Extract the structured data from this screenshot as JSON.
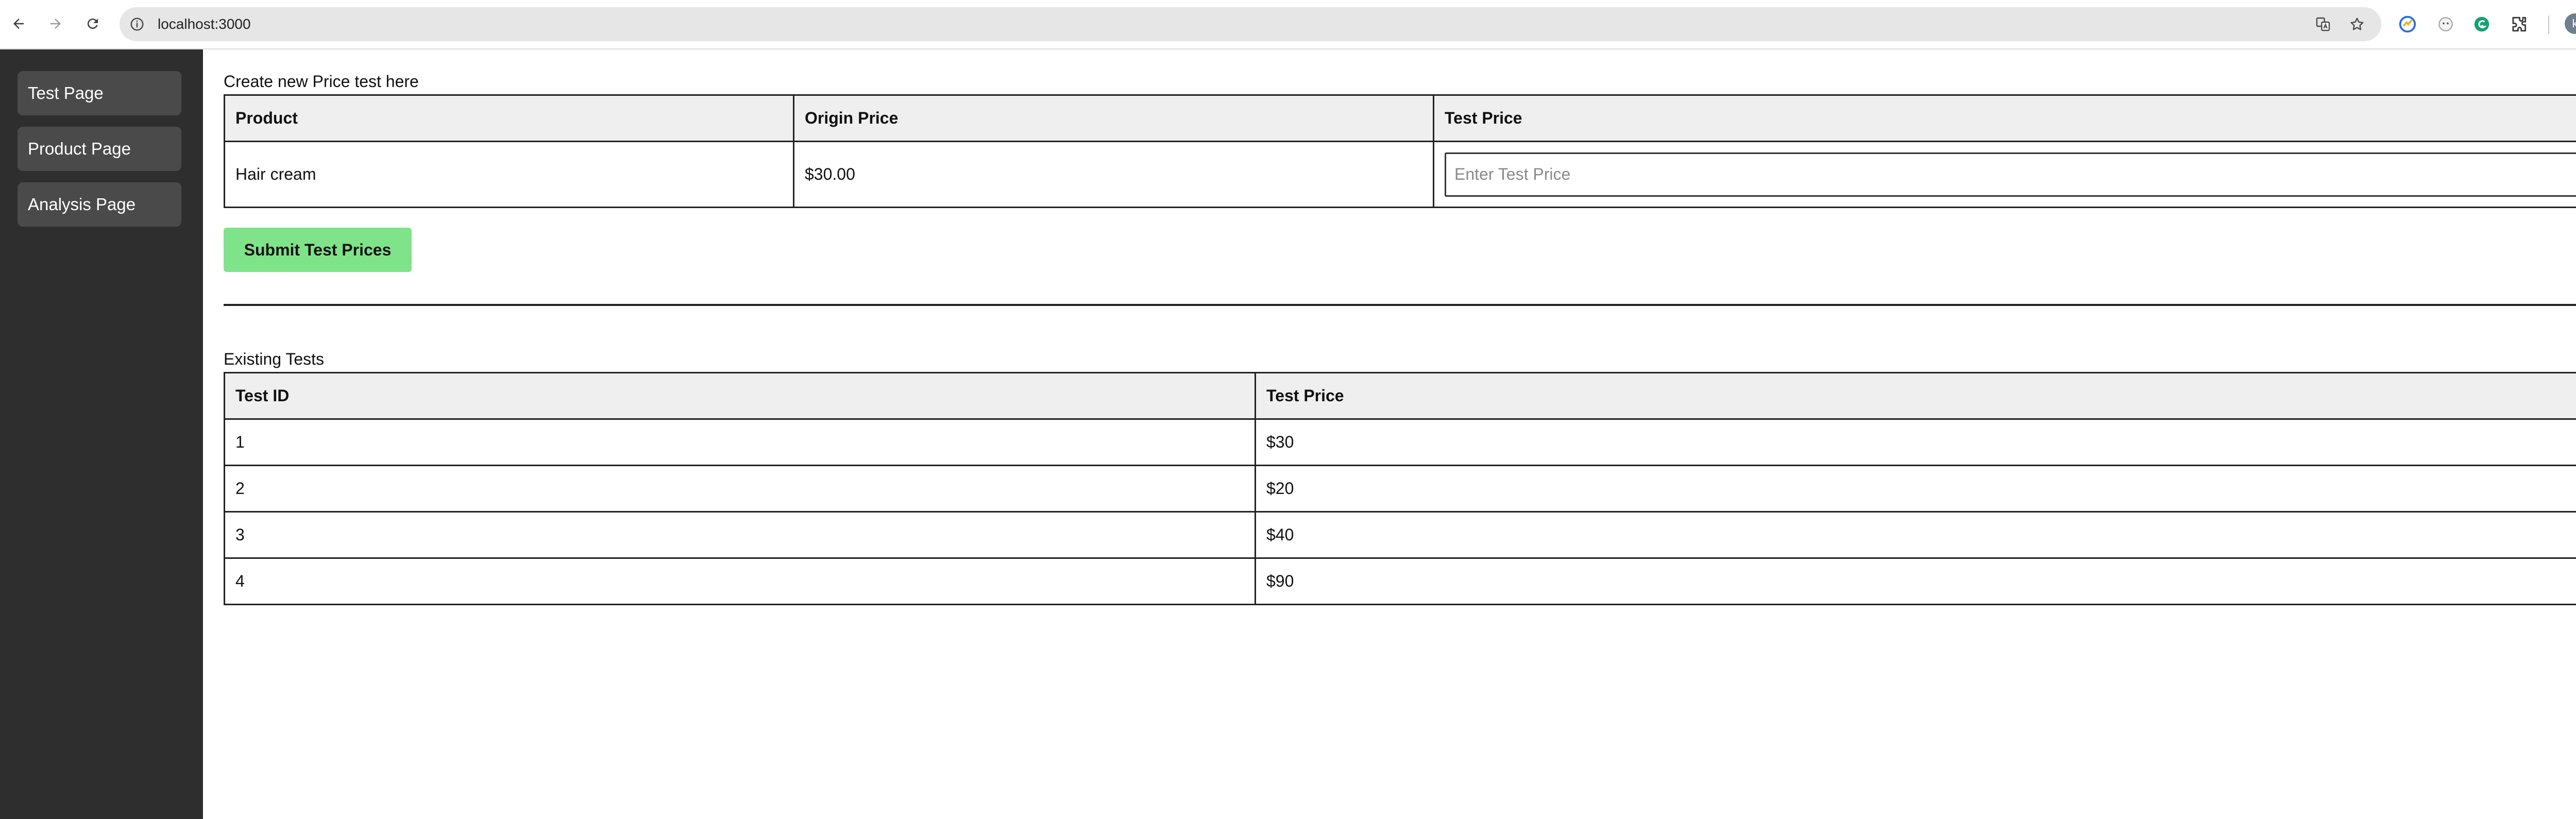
{
  "browser": {
    "url": "localhost:3000",
    "avatar_initial": "k",
    "icons": {
      "back": "arrow-left-icon",
      "forward": "arrow-right-icon",
      "reload": "reload-icon",
      "site_info": "info-circle-icon",
      "translate": "translate-icon",
      "bookmark": "star-icon",
      "extensions": "puzzle-icon",
      "menu": "more-vertical-icon"
    }
  },
  "sidebar": {
    "items": [
      {
        "label": "Test Page"
      },
      {
        "label": "Product Page"
      },
      {
        "label": "Analysis Page"
      }
    ]
  },
  "create_section": {
    "caption": "Create new Price test here",
    "headers": [
      "Product",
      "Origin Price",
      "Test Price"
    ],
    "row": {
      "product": "Hair cream",
      "origin_price": "$30.00",
      "test_price_value": "",
      "test_price_placeholder": "Enter Test Price"
    },
    "submit_label": "Submit Test Prices"
  },
  "existing_section": {
    "caption": "Existing Tests",
    "headers": [
      "Test ID",
      "Test Price"
    ],
    "rows": [
      {
        "id": "1",
        "price": "$30"
      },
      {
        "id": "2",
        "price": "$20"
      },
      {
        "id": "3",
        "price": "$40"
      },
      {
        "id": "4",
        "price": "$90"
      }
    ]
  },
  "colors": {
    "sidebar_bg": "#2e2e2e",
    "sidebar_button": "#4a4a4a",
    "submit_button": "#7fe38a",
    "table_header_bg": "#efefef"
  }
}
